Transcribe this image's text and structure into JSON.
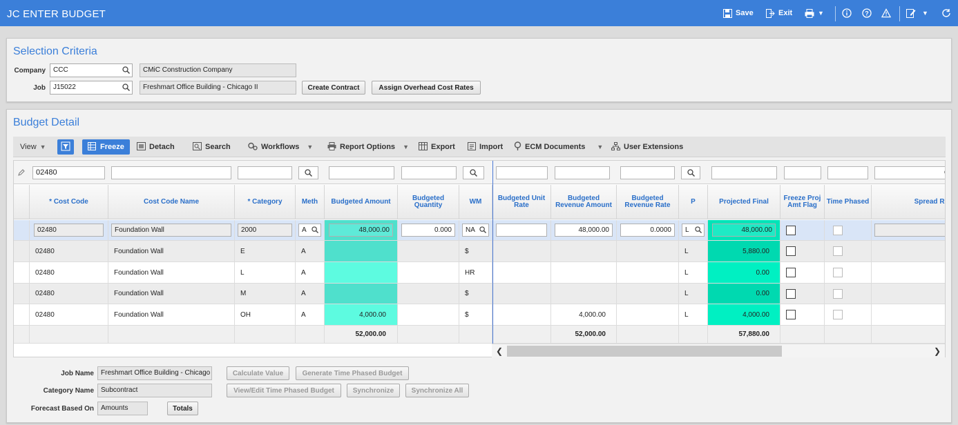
{
  "app": {
    "title": "JC ENTER BUDGET"
  },
  "titlebar": {
    "save": "Save",
    "exit": "Exit"
  },
  "selection": {
    "title": "Selection Criteria",
    "company_label": "Company",
    "company_value": "CCC",
    "company_name": "CMiC Construction Company",
    "job_label": "Job",
    "job_value": "J15022",
    "job_name": "Freshmart Office Building - Chicago II",
    "create_contract": "Create Contract",
    "assign_overhead": "Assign Overhead Cost Rates"
  },
  "budget": {
    "title": "Budget Detail",
    "toolbar": {
      "view": "View",
      "freeze": "Freeze",
      "detach": "Detach",
      "search": "Search",
      "workflows": "Workflows",
      "report_options": "Report Options",
      "export": "Export",
      "import": "Import",
      "ecm": "ECM Documents",
      "user_ext": "User Extensions"
    },
    "filter_cost_code": "02480",
    "columns": {
      "cost_code": "* Cost Code",
      "cost_code_name": "Cost Code Name",
      "category": "* Category",
      "meth": "Meth",
      "budgeted_amount": "Budgeted Amount",
      "budgeted_quantity": "Budgeted Quantity",
      "wm": "WM",
      "budgeted_unit_rate": "Budgeted Unit Rate",
      "budgeted_revenue_amount": "Budgeted Revenue Amount",
      "budgeted_revenue_rate": "Budgeted Revenue Rate",
      "p": "P",
      "projected_final": "Projected Final",
      "freeze_flag": "Freeze Proj Amt Flag",
      "time_phased": "Time Phased",
      "spread_rule": "Spread Rule"
    },
    "edit_row": {
      "cost_code": "02480",
      "name": "Foundation Wall",
      "category": "2000",
      "meth": "A",
      "amount": "48,000.00",
      "quantity": "0.000",
      "wm": "NA",
      "unit_rate": "",
      "revenue_amount": "48,000.00",
      "revenue_rate": "0.0000",
      "p": "L",
      "projected": "48,000.00"
    },
    "rows": [
      {
        "cost_code": "02480",
        "name": "Foundation Wall",
        "category": "E",
        "meth": "A",
        "amount": "",
        "wm": "$",
        "revenue_amount": "",
        "p": "L",
        "projected": "5,880.00"
      },
      {
        "cost_code": "02480",
        "name": "Foundation Wall",
        "category": "L",
        "meth": "A",
        "amount": "",
        "wm": "HR",
        "revenue_amount": "",
        "p": "L",
        "projected": "0.00"
      },
      {
        "cost_code": "02480",
        "name": "Foundation Wall",
        "category": "M",
        "meth": "A",
        "amount": "",
        "wm": "$",
        "revenue_amount": "",
        "p": "L",
        "projected": "0.00"
      },
      {
        "cost_code": "02480",
        "name": "Foundation Wall",
        "category": "OH",
        "meth": "A",
        "amount": "4,000.00",
        "wm": "$",
        "revenue_amount": "4,000.00",
        "p": "L",
        "projected": "4,000.00"
      }
    ],
    "totals": {
      "amount": "52,000.00",
      "revenue_amount": "52,000.00",
      "projected": "57,880.00"
    }
  },
  "bottom": {
    "job_name_label": "Job Name",
    "job_name_value": "Freshmart Office Building - Chicago II",
    "category_name_label": "Category Name",
    "category_name_value": "Subcontract",
    "forecast_label": "Forecast Based On",
    "forecast_value": "Amounts",
    "calculate_value": "Calculate Value",
    "generate_tp": "Generate Time Phased Budget",
    "view_edit_tp": "View/Edit Time Phased Budget",
    "synchronize": "Synchronize",
    "synchronize_all": "Synchronize All",
    "totals": "Totals"
  },
  "colors": {
    "accent": "#3b7fd9",
    "teal_amount": "#4fe0cc",
    "teal_projected": "#00e4b8"
  }
}
